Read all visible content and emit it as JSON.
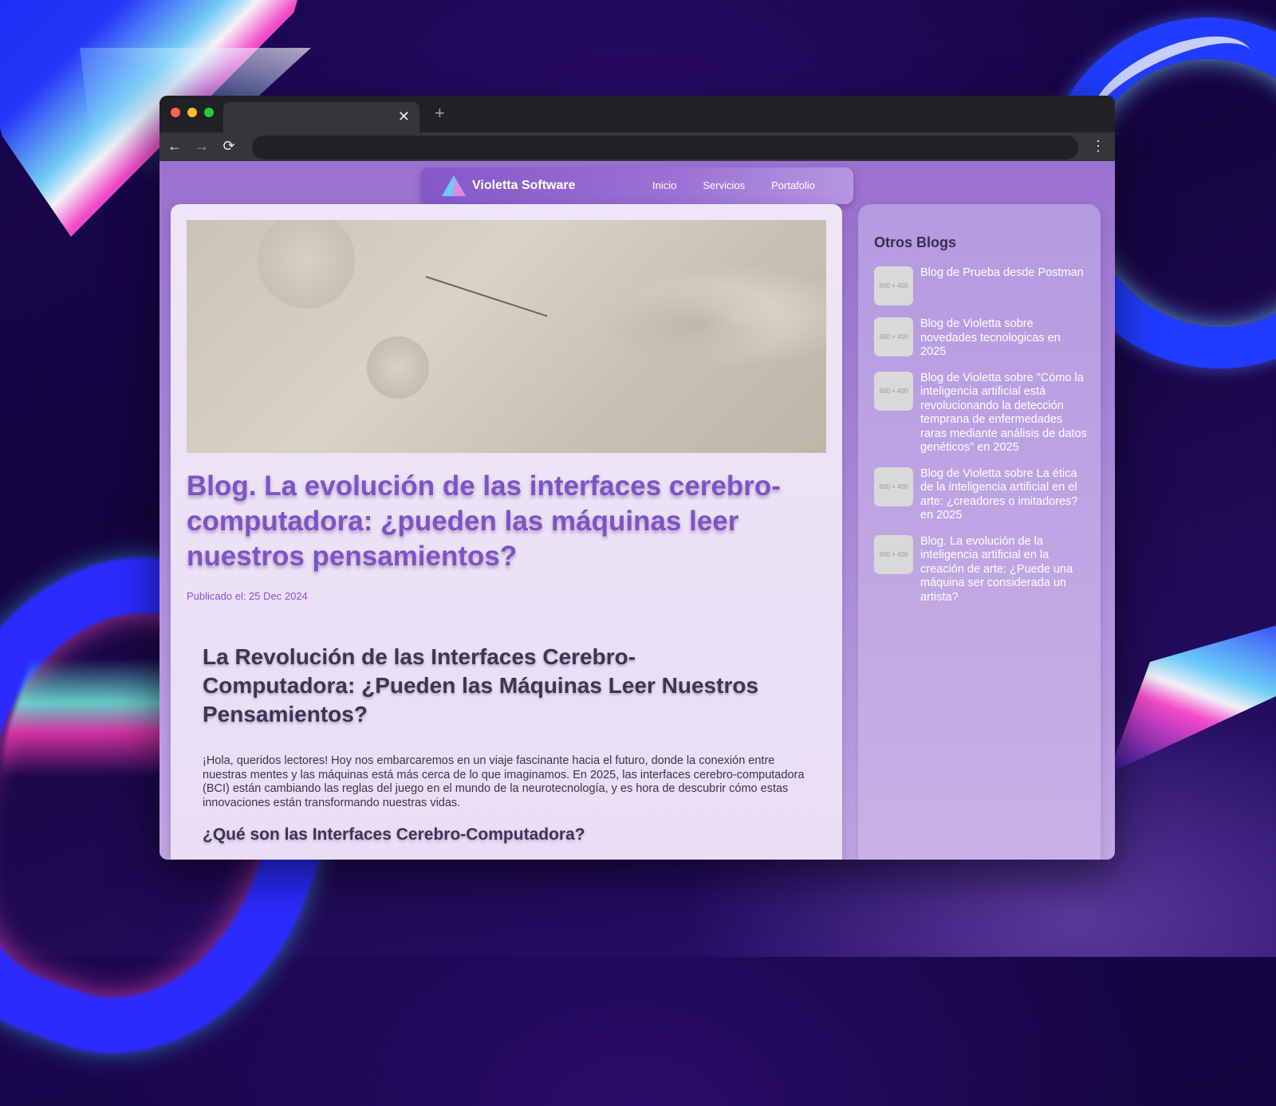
{
  "browser": {
    "tab_close": "✕",
    "new_tab": "+",
    "back": "←",
    "forward": "→",
    "reload": "⟳",
    "menu": "⋮"
  },
  "site": {
    "brand": "Violetta Software",
    "nav": [
      "Inicio",
      "Servicios",
      "Portafolio"
    ]
  },
  "article": {
    "title": "Blog. La evolución de las interfaces cerebro-computadora: ¿pueden las máquinas leer nuestros pensamientos?",
    "published": "Publicado el: 25 Dec 2024",
    "heading": "La Revolución de las Interfaces Cerebro-Computadora: ¿Pueden las Máquinas Leer Nuestros Pensamientos?",
    "intro": "¡Hola, queridos lectores! Hoy nos embarcaremos en un viaje fascinante hacia el futuro, donde la conexión entre nuestras mentes y las máquinas está más cerca de lo que imaginamos. En 2025, las interfaces cerebro-computadora (BCI) están cambiando las reglas del juego en el mundo de la neurotecnología, y es hora de descubrir cómo estas innovaciones están transformando nuestras vidas.",
    "subheading": "¿Qué son las Interfaces Cerebro-Computadora?"
  },
  "sidebar": {
    "title": "Otros Blogs",
    "thumb_label": "600 × 400",
    "items": [
      "Blog de Prueba desde Postman",
      "Blog de Violetta sobre novedades tecnologicas en 2025",
      "Blog de Violetta sobre \"Cómo la inteligencia artificial está revolucionando la detección temprana de enfermedades raras mediante análisis de datos genéticos\" en 2025",
      "Blog de Violetta sobre La ética de la inteligencia artificial en el arte: ¿creadores o imitadores? en 2025",
      "Blog. La evolución de la inteligencia artificial en la creación de arte: ¿Puede una máquina ser considerada un artista?"
    ]
  },
  "colors": {
    "accent": "#7d54c6",
    "nav_bg": "#8558c8",
    "page_bg": "#9a72cf"
  }
}
